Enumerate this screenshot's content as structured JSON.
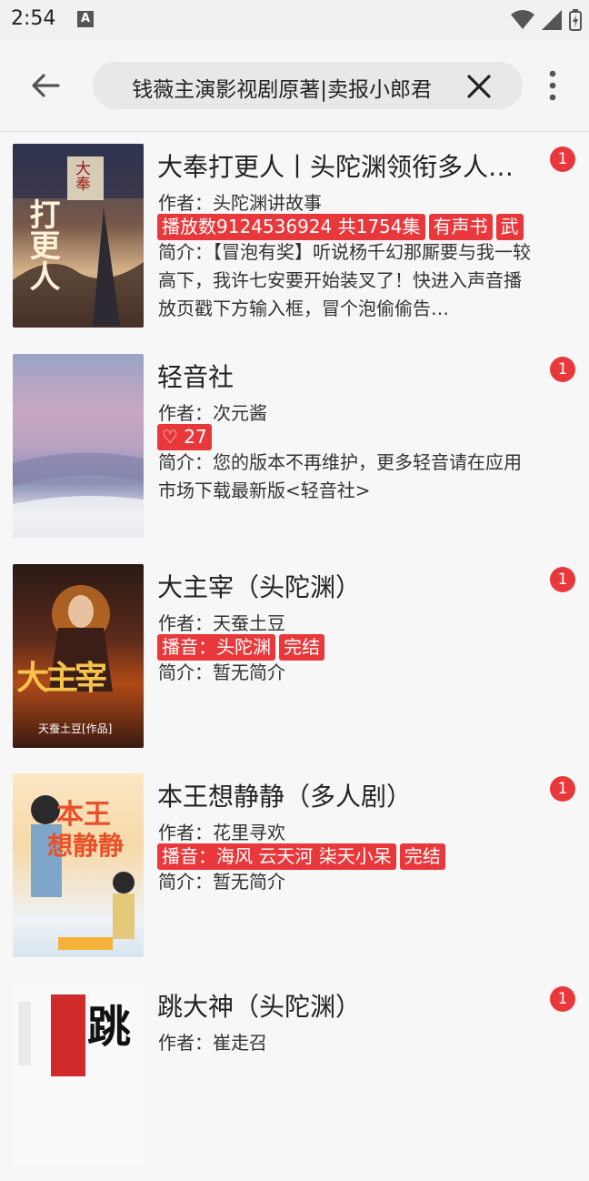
{
  "status_bar": {
    "time": "2:54",
    "notification_icon": "A"
  },
  "toolbar": {
    "search_value": "钱薇主演影视剧原著|卖报小郎君",
    "icons": [
      "arrow-back-icon",
      "close-icon",
      "more-vert-icon"
    ]
  },
  "items": [
    {
      "title": "大奉打更人丨头陀渊领衔多人演播",
      "author": "作者：头陀渊讲故事",
      "tags": [
        "播放数9124536924 共1754集",
        "有声书",
        "武"
      ],
      "intro": "简介：【冒泡有奖】听说杨千幻那厮要与我一较高下，我许七安要开始装叉了！快进入声音播放页戳下方输入框，冒个泡偷偷告…",
      "badge": "1",
      "cover_text": [
        "大奉",
        "打更人"
      ]
    },
    {
      "title": "轻音社",
      "author": "作者：次元酱",
      "tags": [
        "♡ 27"
      ],
      "intro": "简介：您的版本不再维护，更多轻音请在应用市场下载最新版<轻音社>",
      "badge": "1",
      "cover_text": []
    },
    {
      "title": "大主宰（头陀渊）",
      "author": "作者：天蚕土豆",
      "tags": [
        "播音：头陀渊",
        "完结"
      ],
      "intro": "简介：暂无简介",
      "badge": "1",
      "cover_text": [
        "大主宰",
        "天蚕土豆[作品]"
      ]
    },
    {
      "title": "本王想静静（多人剧）",
      "author": "作者：花里寻欢",
      "tags": [
        "播音：海风 云天河 柒天小呆",
        "完结"
      ],
      "intro": "简介：暂无简介",
      "badge": "1",
      "cover_text": [
        "本王",
        "想静静"
      ]
    },
    {
      "title": "跳大神（头陀渊）",
      "author": "作者：崔走召",
      "tags": [],
      "intro": "",
      "badge": "1",
      "cover_text": [
        "跳"
      ]
    }
  ],
  "colors": {
    "accent": "#e9383b",
    "background": "#f7f7f7"
  }
}
